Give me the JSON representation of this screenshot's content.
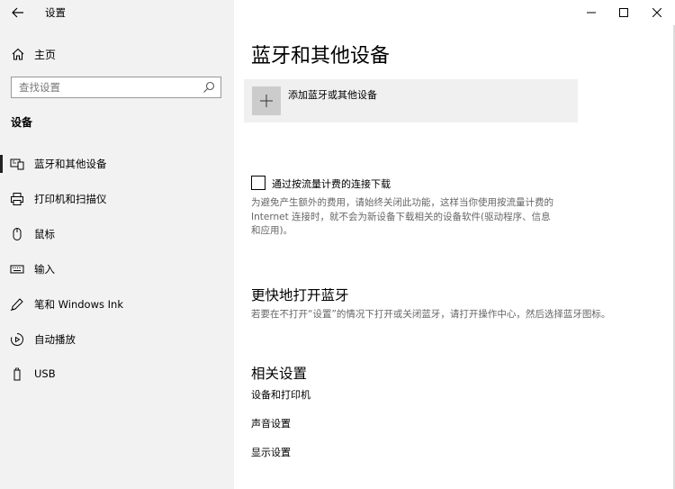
{
  "window": {
    "title": "设置"
  },
  "sidebar": {
    "home_label": "主页",
    "search_placeholder": "查找设置",
    "section_title": "设备",
    "items": [
      {
        "label": "蓝牙和其他设备",
        "icon": "bluetooth-devices-icon",
        "active": true
      },
      {
        "label": "打印机和扫描仪",
        "icon": "printer-icon",
        "active": false
      },
      {
        "label": "鼠标",
        "icon": "mouse-icon",
        "active": false
      },
      {
        "label": "输入",
        "icon": "keyboard-icon",
        "active": false
      },
      {
        "label": "笔和 Windows Ink",
        "icon": "pen-icon",
        "active": false
      },
      {
        "label": "自动播放",
        "icon": "autoplay-icon",
        "active": false
      },
      {
        "label": "USB",
        "icon": "usb-icon",
        "active": false
      }
    ]
  },
  "main": {
    "title": "蓝牙和其他设备",
    "add_device_label": "添加蓝牙或其他设备",
    "metered": {
      "checkbox_label": "通过按流量计费的连接下载",
      "checked": false,
      "desc_lines": [
        "为避免产生额外的费用，请始终关闭此功能，这样当你使用按流量计费的",
        "Internet 连接时，就不会为新设备下载相关的设备软件(驱动程序、信息",
        "和应用)。"
      ]
    },
    "quick_bt": {
      "heading": "更快地打开蓝牙",
      "desc": "若要在不打开“设置”的情况下打开或关闭蓝牙，请打开操作中心，然后选择蓝牙图标。"
    },
    "related": {
      "heading": "相关设置",
      "links": [
        "设备和打印机",
        "声音设置",
        "显示设置"
      ]
    }
  }
}
